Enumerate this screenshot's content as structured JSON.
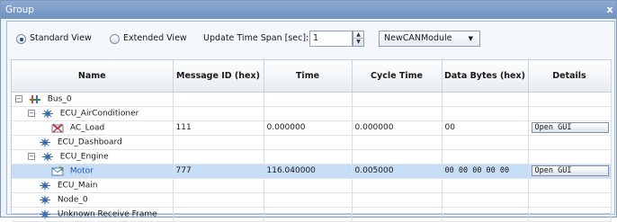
{
  "window": {
    "title": "Group",
    "close_label": "x"
  },
  "toolbar": {
    "standard_view_label": "Standard View",
    "extended_view_label": "Extended View",
    "update_span_label": "Update Time Span [sec]:",
    "update_span_value": "1",
    "module_select_value": "NewCANModule"
  },
  "table": {
    "headers": [
      "Name",
      "Message ID (hex)",
      "Time",
      "Cycle Time",
      "Data Bytes (hex)",
      "Details"
    ],
    "rows": [
      {
        "name": "Bus_0",
        "id": "",
        "time": "",
        "cycle": "",
        "data": "",
        "details": ""
      },
      {
        "name": "ECU_AirConditioner",
        "id": "",
        "time": "",
        "cycle": "",
        "data": "",
        "details": ""
      },
      {
        "name": "AC_Load",
        "id": "111",
        "time": "0.000000",
        "cycle": "0.000000",
        "data": "00",
        "details": "Open GUI"
      },
      {
        "name": "ECU_Dashboard",
        "id": "",
        "time": "",
        "cycle": "",
        "data": "",
        "details": ""
      },
      {
        "name": "ECU_Engine",
        "id": "",
        "time": "",
        "cycle": "",
        "data": "",
        "details": ""
      },
      {
        "name": "Motor",
        "id": "777",
        "time": "116.040000",
        "cycle": "0.005000",
        "data": "00 00 00 00 00",
        "details": "Open GUI"
      },
      {
        "name": "ECU_Main",
        "id": "",
        "time": "",
        "cycle": "",
        "data": "",
        "details": ""
      },
      {
        "name": "Node_0",
        "id": "",
        "time": "",
        "cycle": "",
        "data": "",
        "details": ""
      },
      {
        "name": "Unknown Receive Frame",
        "id": "",
        "time": "",
        "cycle": "",
        "data": "",
        "details": ""
      }
    ]
  }
}
